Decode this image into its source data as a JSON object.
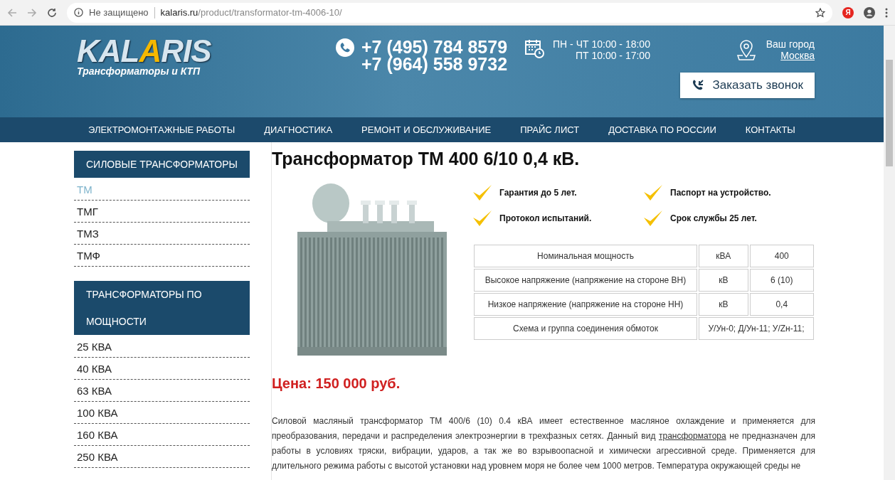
{
  "browser": {
    "security": "Не защищено",
    "url_host": "kalaris.ru",
    "url_path": "/product/transformator-tm-4006-10/",
    "extension_badge": "Я"
  },
  "header": {
    "logo": {
      "before": "KAL",
      "accent": "A",
      "after": "RIS",
      "tagline": "Трансформаторы и КТП"
    },
    "phones": [
      "+7 (495) 784 8579",
      "+7 (964) 558 9732"
    ],
    "hours": [
      "ПН - ЧТ 10:00 - 18:00",
      "ПТ 10:00 - 17:00"
    ],
    "city_label": "Ваш город",
    "city": "Москва",
    "callback_button": "Заказать звонок"
  },
  "nav": [
    "ЭЛЕКТРОМОНТАЖНЫЕ РАБОТЫ",
    "ДИАГНОСТИКА",
    "РЕМОНТ И ОБСЛУЖИВАНИЕ",
    "ПРАЙС ЛИСТ",
    "ДОСТАВКА ПО РОССИИ",
    "КОНТАКТЫ"
  ],
  "sidebar": [
    {
      "title": "СИЛОВЫЕ ТРАНСФОРМАТОРЫ",
      "items": [
        {
          "label": "ТМ",
          "selected": true
        },
        {
          "label": "ТМГ",
          "selected": false
        },
        {
          "label": "ТМЗ",
          "selected": false
        },
        {
          "label": "ТМФ",
          "selected": false
        }
      ]
    },
    {
      "title": "ТРАНСФОРМАТОРЫ ПО МОЩНОСТИ",
      "items": [
        {
          "label": "25 КВА",
          "selected": false
        },
        {
          "label": "40 КВА",
          "selected": false
        },
        {
          "label": "63 КВА",
          "selected": false
        },
        {
          "label": "100 КВА",
          "selected": false
        },
        {
          "label": "160 КВА",
          "selected": false
        },
        {
          "label": "250 КВА",
          "selected": false
        }
      ]
    }
  ],
  "product": {
    "title": "Трансформатор ТМ 400 6/10 0,4 кВ.",
    "features": [
      "Гарантия до 5 лет.",
      "Паспорт на устройство.",
      "Протокол испытаний.",
      "Срок службы 25 лет."
    ],
    "specs": [
      [
        "Номинальная мощность",
        "кВА",
        "400"
      ],
      [
        "Высокое напряжение (напряжение на стороне ВН)",
        "кВ",
        "6 (10)"
      ],
      [
        "Низкое напряжение (напряжение на стороне НН)",
        "кВ",
        "0,4"
      ],
      [
        "Схема и группа соединения обмоток",
        "У/Ун-0; Д/Ун-11; У/Zн-11;"
      ]
    ],
    "price": "Цена: 150 000 руб.",
    "description": {
      "before": "Силовой масляный трансформатор ТМ 400/6 (10) 0.4 кВА имеет естественное масляное охлаждение и применяется для преобразования, передачи и распределения электроэнергии в трехфазных сетях. Данный вид",
      "link": "трансформатора",
      "after": "не предназначен для работы в условиях тряски, вибрации, ударов, а так же во взрывоопасной и химически агрессивной среде. Применяется для длительного режима работы с высотой установки над уровнем моря не более чем 1000 метров. Температура окружающей среды не"
    }
  }
}
